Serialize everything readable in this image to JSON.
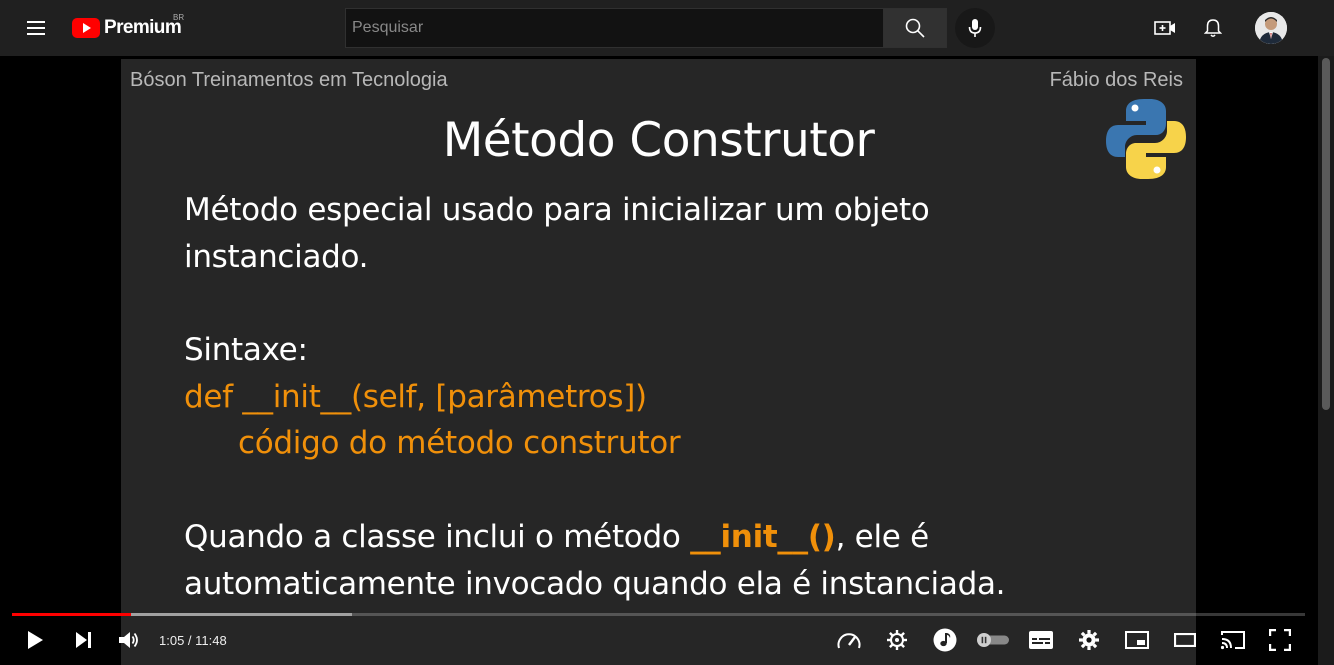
{
  "header": {
    "logo_text": "Premium",
    "logo_region": "BR",
    "search_placeholder": "Pesquisar",
    "icons": [
      "menu-icon",
      "search-icon",
      "mic-icon",
      "create-icon",
      "bell-icon",
      "avatar"
    ]
  },
  "slide": {
    "top_left": "Bóson Treinamentos em Tecnologia",
    "top_right": "Fábio dos Reis",
    "title": "Método Construtor",
    "line1": "Método especial usado para inicializar um objeto",
    "line2": "instanciado.",
    "syntax_label": "Sintaxe:",
    "code_line1": "def __init__(self, [parâmetros])",
    "code_line2": "código do método construtor",
    "line3_a": "Quando a classe inclui o método ",
    "line3_b": "__init__()",
    "line3_c": ", ele é",
    "line4": "automaticamente invocado quando ela é instanciada."
  },
  "player": {
    "current_time": "1:05",
    "separator": " / ",
    "duration": "11:48",
    "progress_played": 0.092,
    "progress_buffered": 0.263,
    "colors": {
      "played": "#ff0000",
      "code": "#f0900a"
    },
    "control_icons": [
      "play-icon",
      "next-icon",
      "volume-icon",
      "speed-icon",
      "settings-gear-icon",
      "music-icon",
      "autoplay-toggle",
      "subtitles-icon",
      "settings-icon",
      "miniplayer-icon",
      "theater-icon",
      "cast-icon",
      "fullscreen-icon"
    ]
  }
}
